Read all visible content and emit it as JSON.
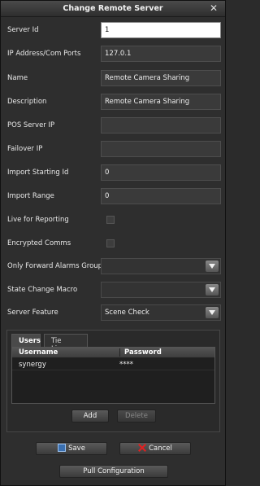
{
  "window": {
    "title": "Change Remote Server"
  },
  "fields": [
    {
      "label": "Server Id",
      "value": "1"
    },
    {
      "label": "IP Address/Com Ports",
      "value": "127.0.1"
    },
    {
      "label": "Name",
      "value": "Remote Camera Sharing"
    },
    {
      "label": "Description",
      "value": "Remote Camera Sharing"
    },
    {
      "label": "POS Server IP",
      "value": ""
    },
    {
      "label": "Failover IP",
      "value": ""
    },
    {
      "label": "Import Starting Id",
      "value": "0"
    },
    {
      "label": "Import Range",
      "value": "0"
    }
  ],
  "checkboxes": [
    {
      "label": "Live for Reporting",
      "checked": false
    },
    {
      "label": "Encrypted Comms",
      "checked": false
    }
  ],
  "combos": [
    {
      "label": "Only Forward Alarms Group",
      "value": ""
    },
    {
      "label": "State Change Macro",
      "value": ""
    },
    {
      "label": "Server Feature",
      "value": "Scene Check"
    }
  ],
  "tabs": {
    "users": "Users",
    "tie_lines": "Tie Lines"
  },
  "users_table": {
    "headers": [
      "Username",
      "Password"
    ],
    "rows": [
      {
        "username": "synergy",
        "password": "****"
      }
    ]
  },
  "buttons": {
    "add": "Add",
    "delete": "Delete",
    "save": "Save",
    "cancel": "Cancel",
    "pull": "Pull Configuration"
  },
  "icons": {
    "close": "close-icon",
    "save": "floppy-disk-icon",
    "cancel": "red-x-icon",
    "dropdown": "chevron-down-icon"
  }
}
